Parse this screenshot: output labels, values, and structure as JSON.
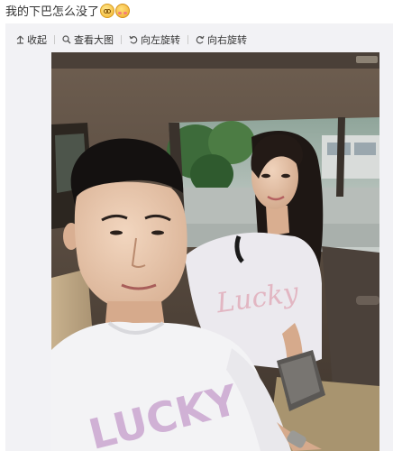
{
  "post": {
    "text": "我的下巴怎么没了",
    "emojis": [
      "dizzy-face-emoji",
      "blushing-face-emoji"
    ]
  },
  "toolbar": {
    "collapse_label": "收起",
    "view_large_label": "查看大图",
    "rotate_left_label": "向左旋转",
    "rotate_right_label": "向右旋转"
  },
  "photo": {
    "shirt_text_front": "LUCKY",
    "shirt_text_back": "Lucky"
  },
  "colors": {
    "text": "#333333",
    "panel_bg": "#f2f2f5"
  }
}
